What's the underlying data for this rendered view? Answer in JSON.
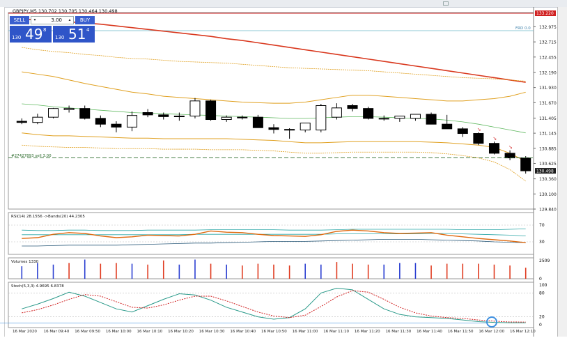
{
  "chart_header": {
    "text": "GBPJPY,M5  130.702 130.705 130.464 130.498"
  },
  "trade_panel": {
    "sell_label": "SELL",
    "buy_label": "BUY",
    "lot_value": "3.00",
    "sell_prefix": "130",
    "sell_big": "49",
    "sell_sup": "8",
    "buy_prefix": "130",
    "buy_big": "51",
    "buy_sup": "4"
  },
  "price_axis": {
    "labels": [
      "132.975",
      "132.715",
      "132.455",
      "132.190",
      "131.930",
      "131.670",
      "131.405",
      "131.145",
      "130.885",
      "130.625",
      "130.360",
      "130.100",
      "129.840"
    ],
    "red_level": "133.220",
    "current": "130.498",
    "frd_label": "FRD 0.0"
  },
  "order_line_label": "#27427893 sell 3.00",
  "rsi": {
    "label": "RSI(14) 28.1556  ->Bands(20) 44.2305",
    "levels": [
      "70",
      "30"
    ]
  },
  "volumes": {
    "label": "Volumes 1330",
    "axis_top": "2509",
    "axis_bottom": "0"
  },
  "stoch": {
    "label": "Stoch(5,3,3) 4.9695 6.8378",
    "levels": [
      "100",
      "80",
      "20",
      "0"
    ]
  },
  "time_axis": [
    "16 Mar 2020",
    "16 Mar 09:40",
    "16 Mar 09:50",
    "16 Mar 10:00",
    "16 Mar 10:10",
    "16 Mar 10:20",
    "16 Mar 10:30",
    "16 Mar 10:40",
    "16 Mar 10:50",
    "16 Mar 11:00",
    "16 Mar 11:10",
    "16 Mar 11:20",
    "16 Mar 11:30",
    "16 Mar 11:40",
    "16 Mar 11:50",
    "16 Mar 12:00",
    "16 Mar 12:10"
  ],
  "colors": {
    "bull": "#ffffff",
    "bear": "#000000",
    "ma_red": "#d9381e",
    "band_orange": "#e0a020",
    "green_ma": "#5fb85f",
    "vol_up": "#2b3fd1",
    "vol_down": "#e03a1f",
    "stoch_main": "#2a9a8a",
    "stoch_signal": "#d02020",
    "rsi_line": "#e06a10",
    "rsi_band": "#2aa6a6"
  },
  "chart_data": [
    {
      "type": "candlestick",
      "title": "GBPJPY,M5",
      "x": [
        "09:25",
        "09:30",
        "09:35",
        "09:40",
        "09:45",
        "09:50",
        "09:55",
        "10:00",
        "10:05",
        "10:10",
        "10:15",
        "10:20",
        "10:25",
        "10:30",
        "10:35",
        "10:40",
        "10:45",
        "10:50",
        "10:55",
        "11:00",
        "11:05",
        "11:10",
        "11:15",
        "11:20",
        "11:25",
        "11:30",
        "11:35",
        "11:40",
        "11:45",
        "11:50",
        "11:55",
        "12:00",
        "12:05"
      ],
      "open": [
        131.35,
        131.33,
        131.42,
        131.55,
        131.57,
        131.4,
        131.3,
        131.25,
        131.5,
        131.46,
        131.43,
        131.44,
        131.7,
        131.38,
        131.42,
        131.42,
        131.24,
        131.21,
        131.2,
        131.2,
        131.42,
        131.62,
        131.57,
        131.4,
        131.4,
        131.4,
        131.47,
        131.3,
        131.22,
        131.14,
        130.97,
        130.8,
        130.72
      ],
      "high": [
        131.4,
        131.48,
        131.58,
        131.62,
        131.62,
        131.45,
        131.35,
        131.52,
        131.56,
        131.5,
        131.5,
        131.75,
        131.72,
        131.45,
        131.45,
        131.46,
        131.3,
        131.23,
        131.24,
        131.65,
        131.66,
        131.65,
        131.6,
        131.45,
        131.44,
        131.46,
        131.5,
        131.46,
        131.25,
        131.16,
        131.0,
        130.85,
        130.75
      ],
      "low": [
        131.3,
        131.3,
        131.4,
        131.5,
        131.38,
        131.25,
        131.16,
        131.18,
        131.42,
        131.38,
        131.36,
        131.4,
        131.36,
        131.34,
        131.38,
        131.38,
        131.14,
        131.05,
        131.16,
        131.16,
        131.38,
        131.52,
        131.38,
        131.36,
        131.34,
        131.36,
        131.42,
        131.28,
        131.08,
        130.94,
        130.78,
        130.68,
        130.45
      ],
      "close": [
        131.33,
        131.42,
        131.57,
        131.57,
        131.4,
        131.3,
        131.25,
        131.45,
        131.46,
        131.43,
        131.44,
        131.7,
        131.38,
        131.42,
        131.42,
        131.24,
        131.21,
        131.2,
        131.32,
        131.62,
        131.58,
        131.57,
        131.4,
        131.4,
        131.44,
        131.47,
        131.3,
        131.22,
        131.14,
        130.97,
        130.8,
        130.72,
        130.498
      ],
      "ylim": [
        129.84,
        133.22
      ],
      "ma_red": [
        133.11,
        133.09,
        133.08,
        133.06,
        133.04,
        133.02,
        132.99,
        132.96,
        132.93,
        132.9,
        132.87,
        132.84,
        132.81,
        132.77,
        132.74,
        132.7,
        132.66,
        132.62,
        132.58,
        132.54,
        132.5,
        132.46,
        132.42,
        132.38,
        132.34,
        132.3,
        132.26,
        132.22,
        132.18,
        132.14,
        132.1,
        132.06,
        132.02
      ],
      "band_upper_outer": [
        132.62,
        132.58,
        132.55,
        132.53,
        132.5,
        132.48,
        132.45,
        132.43,
        132.42,
        132.4,
        132.38,
        132.37,
        132.36,
        132.35,
        132.33,
        132.31,
        132.29,
        132.27,
        132.26,
        132.25,
        132.24,
        132.23,
        132.22,
        132.2,
        132.18,
        132.16,
        132.14,
        132.12,
        132.1,
        132.09,
        132.08,
        132.06,
        132.04
      ],
      "band_upper": [
        132.2,
        132.16,
        132.12,
        132.06,
        132.0,
        131.95,
        131.9,
        131.85,
        131.82,
        131.78,
        131.76,
        131.74,
        131.72,
        131.7,
        131.68,
        131.67,
        131.66,
        131.66,
        131.68,
        131.72,
        131.76,
        131.8,
        131.8,
        131.78,
        131.76,
        131.74,
        131.72,
        131.7,
        131.7,
        131.72,
        131.74,
        131.78,
        131.85
      ],
      "green_mid": [
        131.65,
        131.63,
        131.6,
        131.58,
        131.56,
        131.54,
        131.52,
        131.5,
        131.49,
        131.48,
        131.47,
        131.46,
        131.45,
        131.44,
        131.43,
        131.42,
        131.41,
        131.4,
        131.4,
        131.41,
        131.42,
        131.43,
        131.43,
        131.42,
        131.41,
        131.4,
        131.39,
        131.37,
        131.34,
        131.3,
        131.25,
        131.2,
        131.15
      ],
      "band_lower": [
        131.15,
        131.12,
        131.1,
        131.1,
        131.09,
        131.08,
        131.07,
        131.06,
        131.06,
        131.05,
        131.05,
        131.05,
        131.05,
        131.05,
        131.04,
        131.03,
        131.02,
        131.0,
        130.98,
        130.98,
        130.99,
        131.0,
        131.0,
        131.0,
        131.0,
        131.0,
        130.99,
        130.98,
        130.96,
        130.94,
        130.9,
        130.8,
        130.66
      ],
      "band_lower_outer": [
        130.94,
        130.92,
        130.91,
        130.9,
        130.9,
        130.89,
        130.88,
        130.88,
        130.88,
        130.87,
        130.87,
        130.87,
        130.86,
        130.86,
        130.86,
        130.85,
        130.84,
        130.82,
        130.8,
        130.8,
        130.81,
        130.82,
        130.82,
        130.82,
        130.82,
        130.82,
        130.81,
        130.79,
        130.76,
        130.72,
        130.65,
        130.52,
        130.32
      ]
    },
    {
      "type": "line",
      "title": "RSI(14) 28.1556  ->Bands(20) 44.2305",
      "ylim": [
        0,
        100
      ],
      "rsi": [
        38,
        40,
        48,
        52,
        50,
        44,
        40,
        42,
        46,
        45,
        44,
        48,
        56,
        53,
        52,
        48,
        45,
        44,
        43,
        47,
        55,
        58,
        56,
        52,
        50,
        51,
        52,
        46,
        42,
        38,
        35,
        32,
        28
      ],
      "band_upper": [
        58,
        57,
        57,
        58,
        58,
        57,
        57,
        57,
        58,
        58,
        58,
        58,
        59,
        59,
        59,
        59,
        59,
        58,
        58,
        58,
        59,
        60,
        60,
        60,
        60,
        60,
        60,
        60,
        59,
        59,
        59,
        60,
        61
      ],
      "band_mid": [
        47,
        47,
        47,
        47,
        47,
        47,
        47,
        47,
        47,
        47,
        47,
        48,
        48,
        48,
        48,
        48,
        48,
        48,
        48,
        48,
        49,
        49,
        49,
        49,
        49,
        49,
        50,
        50,
        49,
        48,
        47,
        46,
        44
      ],
      "band_lower": [
        20,
        20,
        21,
        22,
        22,
        22,
        22,
        23,
        24,
        25,
        26,
        27,
        27,
        28,
        29,
        30,
        31,
        31,
        31,
        32,
        33,
        34,
        35,
        36,
        36,
        36,
        35,
        34,
        33,
        32,
        30,
        29,
        28
      ]
    },
    {
      "type": "bar",
      "title": "Volumes 1330",
      "ylim": [
        0,
        2509
      ],
      "values": [
        1500,
        1900,
        1700,
        1900,
        2300,
        1800,
        1900,
        1800,
        1700,
        2200,
        1700,
        2300,
        1800,
        1700,
        1600,
        1800,
        1700,
        1600,
        1800,
        1700,
        2000,
        1800,
        1700,
        1700,
        1900,
        1900,
        1600,
        1800,
        1800,
        1800,
        1700,
        1600,
        1330
      ],
      "direction": [
        "up",
        "up",
        "up",
        "down",
        "up",
        "down",
        "down",
        "up",
        "down",
        "down",
        "up",
        "up",
        "down",
        "up",
        "down",
        "down",
        "down",
        "down",
        "up",
        "up",
        "down",
        "down",
        "down",
        "up",
        "up",
        "up",
        "down",
        "down",
        "down",
        "down",
        "down",
        "down",
        "down"
      ]
    },
    {
      "type": "line",
      "title": "Stoch(5,3,3) 4.9695 6.8378",
      "ylim": [
        0,
        100
      ],
      "main": [
        40,
        52,
        66,
        82,
        72,
        56,
        40,
        32,
        48,
        64,
        78,
        75,
        62,
        44,
        32,
        20,
        14,
        18,
        40,
        80,
        92,
        88,
        64,
        40,
        26,
        20,
        18,
        16,
        12,
        8,
        6,
        5,
        4.97
      ],
      "signal": [
        30,
        38,
        50,
        64,
        76,
        72,
        58,
        44,
        42,
        50,
        62,
        72,
        72,
        60,
        46,
        32,
        22,
        18,
        24,
        46,
        70,
        86,
        82,
        64,
        44,
        30,
        22,
        18,
        16,
        12,
        9,
        7,
        6.84
      ]
    }
  ]
}
